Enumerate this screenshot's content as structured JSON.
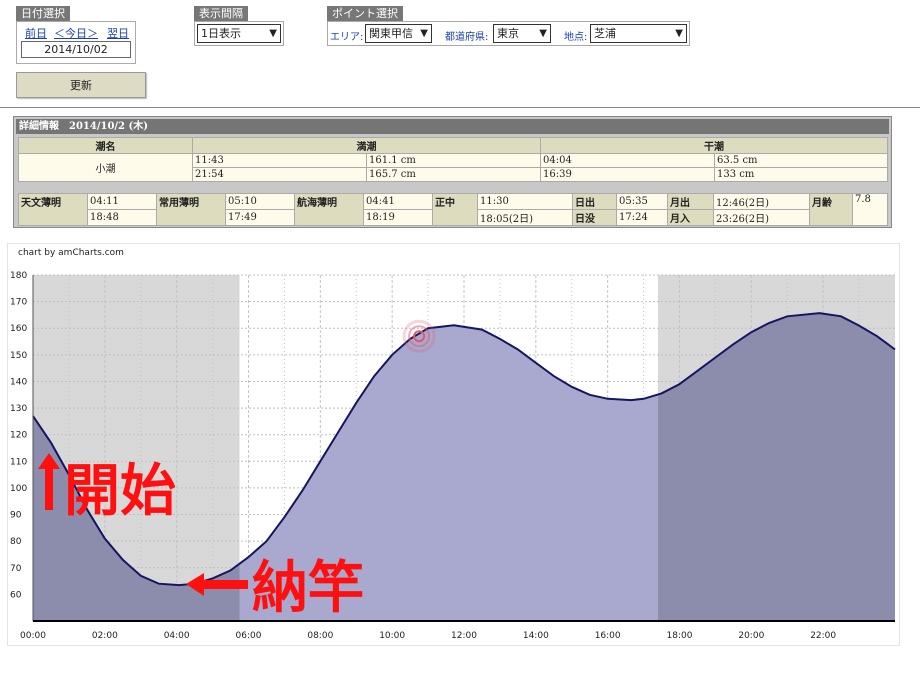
{
  "date_select": {
    "title": "日付選択",
    "prev": "前日",
    "today": "＜今日＞",
    "next": "翌日",
    "value": "2014/10/02"
  },
  "interval_select": {
    "title": "表示間隔",
    "value": "1日表示"
  },
  "point_select": {
    "title": "ポイント選択",
    "area_label": "エリア:",
    "area_value": "関東甲信",
    "pref_label": "都道府県:",
    "pref_value": "東京",
    "spot_label": "地点:",
    "spot_value": "芝浦"
  },
  "update_button": "更新",
  "detail": {
    "heading": "詳細情報　2014/10/2 (木)",
    "tide_name_header": "潮名",
    "tide_name": "小潮",
    "high_header": "満潮",
    "low_header": "干潮",
    "high": [
      {
        "time": "11:43",
        "level": "161.1 cm"
      },
      {
        "time": "21:54",
        "level": "165.7 cm"
      }
    ],
    "low": [
      {
        "time": "04:04",
        "level": "63.5 cm"
      },
      {
        "time": "16:39",
        "level": "133 cm"
      }
    ],
    "astro": {
      "astronomical_twilight": {
        "label": "天文薄明",
        "am": "04:11",
        "pm": "18:48"
      },
      "civil_twilight": {
        "label": "常用薄明",
        "am": "05:10",
        "pm": "17:49"
      },
      "nautical_twilight": {
        "label": "航海薄明",
        "am": "04:41",
        "pm": "18:19"
      },
      "culmination": {
        "label": "正中",
        "am": "11:30",
        "pm": "18:05(2日)"
      },
      "sunrise": {
        "label": "日出",
        "value": "05:35"
      },
      "sunset": {
        "label": "日没",
        "value": "17:24"
      },
      "moonrise": {
        "label": "月出",
        "value": "12:46(2日)"
      },
      "moonset": {
        "label": "月入",
        "value": "23:26(2日)"
      },
      "moon_age": {
        "label": "月齢",
        "value": "7.8"
      }
    }
  },
  "chart_data": {
    "type": "area",
    "credit": "chart by amCharts.com",
    "x_unit": "hour",
    "xlim": [
      0,
      24
    ],
    "ylim": [
      50,
      180
    ],
    "y_ticks": [
      60,
      70,
      80,
      90,
      100,
      110,
      120,
      130,
      140,
      150,
      160,
      170,
      180
    ],
    "x_tick_labels": [
      "00:00",
      "02:00",
      "04:00",
      "06:00",
      "08:00",
      "10:00",
      "12:00",
      "14:00",
      "16:00",
      "18:00",
      "20:00",
      "22:00"
    ],
    "night_shading": [
      [
        0,
        5.75
      ],
      [
        17.4,
        24
      ]
    ],
    "series": [
      {
        "x": [
          0,
          0.5,
          1,
          1.5,
          2,
          2.5,
          3,
          3.5,
          4.07,
          4.5,
          5,
          5.5,
          6,
          6.5,
          7,
          7.5,
          8,
          8.5,
          9,
          9.5,
          10,
          10.5,
          11,
          11.72,
          12.5,
          13,
          13.5,
          14,
          14.5,
          15,
          15.5,
          16,
          16.65,
          17,
          17.5,
          18,
          18.5,
          19,
          19.5,
          20,
          20.5,
          21,
          21.9,
          22.5,
          23,
          23.5,
          24
        ],
        "y": [
          127,
          117,
          105,
          92,
          81,
          73,
          67,
          64,
          63.5,
          64,
          66,
          69,
          74,
          80,
          89,
          99,
          110,
          121,
          132,
          142,
          150,
          156,
          160,
          161.1,
          159.5,
          156,
          152,
          147,
          142,
          138,
          135,
          133.5,
          133,
          133.5,
          135.5,
          139,
          144,
          149,
          154,
          158.5,
          162,
          164.5,
          165.7,
          164.5,
          161,
          157,
          152
        ],
        "values_note": ""
      }
    ],
    "marker": {
      "x": 10.75,
      "y": 157
    },
    "annotations": {
      "start": "開始",
      "stow": "納竿"
    }
  },
  "colors": {
    "line": "#151660",
    "area_day": "#a9a9cf",
    "area_night": "#8c8cad",
    "night_bg": "#d8d8d8",
    "annotation": "#ff1010",
    "marker": "#e05a6a"
  }
}
